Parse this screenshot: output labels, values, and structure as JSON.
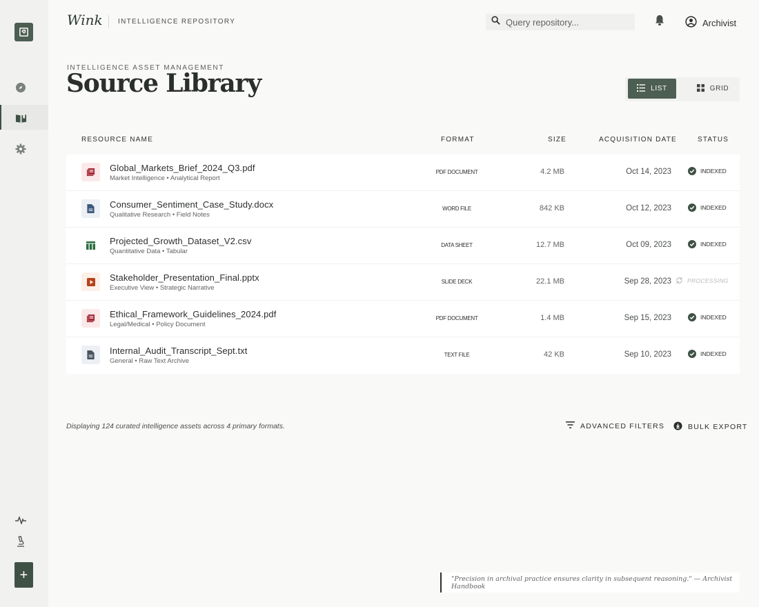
{
  "app": {
    "brand": "Wink",
    "subtitle": "INTELLIGENCE REPOSITORY"
  },
  "header": {
    "search_placeholder": "Query repository...",
    "user_name": "Archivist"
  },
  "sidebar": {
    "items": [
      {
        "icon": "compass-icon",
        "active": false
      },
      {
        "icon": "library-book-icon",
        "active": true
      },
      {
        "icon": "settings-gear-icon",
        "active": false
      }
    ],
    "bottom_icons": [
      "activity-pulse-icon",
      "microscope-icon"
    ],
    "add_label": "+"
  },
  "page": {
    "eyebrow": "INTELLIGENCE ASSET MANAGEMENT",
    "title": "Source Library"
  },
  "view_toggle": {
    "list_label": "LIST",
    "grid_label": "GRID",
    "active": "list"
  },
  "table": {
    "columns": {
      "name": "RESOURCE NAME",
      "format": "FORMAT",
      "size": "SIZE",
      "date": "ACQUISITION DATE",
      "status": "STATUS"
    },
    "rows": [
      {
        "name": "Global_Markets_Brief_2024_Q3.pdf",
        "meta": "Market Intelligence • Analytical Report",
        "format": "PDF DOCUMENT",
        "size": "4.2 MB",
        "date": "Oct 14, 2023",
        "status": "INDEXED",
        "icon": "pdf-icon",
        "icon_color": "#a52a3a",
        "icon_bg": "#fbe9ea"
      },
      {
        "name": "Consumer_Sentiment_Case_Study.docx",
        "meta": "Qualitative Research • Field Notes",
        "format": "WORD FILE",
        "size": "842 KB",
        "date": "Oct 12, 2023",
        "status": "INDEXED",
        "icon": "document-icon",
        "icon_color": "#3d5a7a",
        "icon_bg": "#eceff4"
      },
      {
        "name": "Projected_Growth_Dataset_V2.csv",
        "meta": "Quantitative Data • Tabular",
        "format": "DATA SHEET",
        "size": "12.7 MB",
        "date": "Oct 09, 2023",
        "status": "INDEXED",
        "icon": "table-icon",
        "icon_color": "#2c6e3f",
        "icon_bg": "#ffffff"
      },
      {
        "name": "Stakeholder_Presentation_Final.pptx",
        "meta": "Executive View • Strategic Narrative",
        "format": "SLIDE DECK",
        "size": "22.1 MB",
        "date": "Sep 28, 2023",
        "status": "PROCESSING",
        "icon": "slides-play-icon",
        "icon_color": "#b6421b",
        "icon_bg": "#fdf0e8"
      },
      {
        "name": "Ethical_Framework_Guidelines_2024.pdf",
        "meta": "Legal/Medical • Policy Document",
        "format": "PDF DOCUMENT",
        "size": "1.4 MB",
        "date": "Sep 15, 2023",
        "status": "INDEXED",
        "icon": "pdf-icon",
        "icon_color": "#a52a3a",
        "icon_bg": "#fbe9ea"
      },
      {
        "name": "Internal_Audit_Transcript_Sept.txt",
        "meta": "General • Raw Text Archive",
        "format": "TEXT FILE",
        "size": "42 KB",
        "date": "Sep 10, 2023",
        "status": "INDEXED",
        "icon": "document-icon",
        "icon_color": "#4a5360",
        "icon_bg": "#eceff4"
      }
    ]
  },
  "footer": {
    "summary": "Displaying 124 curated intelligence assets across 4 primary formats.",
    "filters_label": "ADVANCED FILTERS",
    "export_label": "BULK EXPORT"
  },
  "quote": "\"Precision in archival practice ensures clarity in subsequent reasoning.\" — Archivist Handbook",
  "colors": {
    "accent": "#4d5e53",
    "indexed": "#3f5145",
    "processing": "#b9bbb9"
  }
}
